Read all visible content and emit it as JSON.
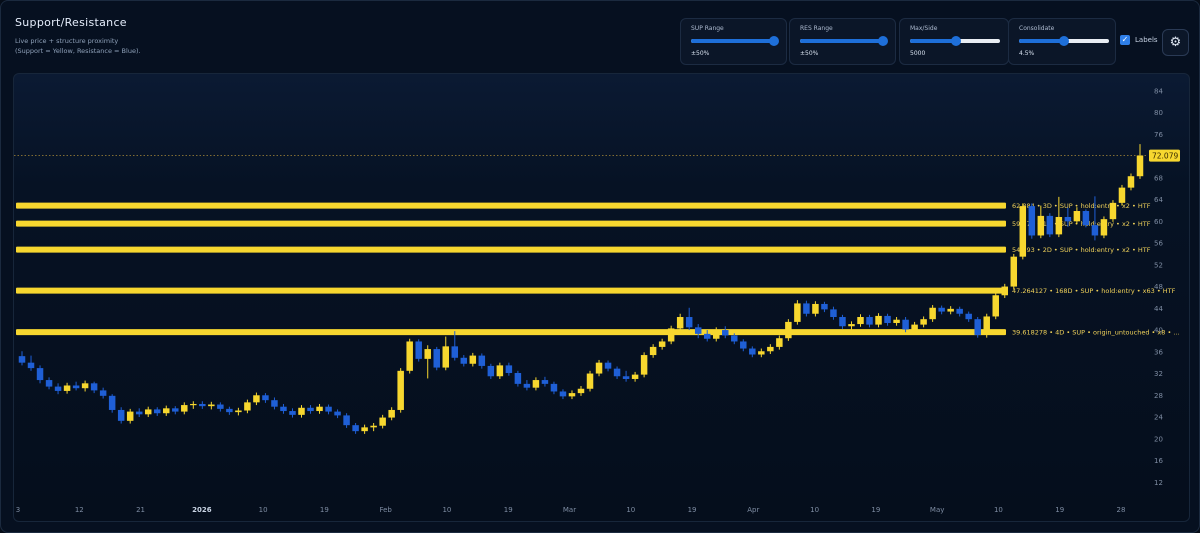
{
  "header": {
    "title": "Support/Resistance",
    "subtitle_line1": "Live price + structure proximity",
    "subtitle_line2": "(Support = Yellow, Resistance = Blue)."
  },
  "controls": {
    "sup_range": {
      "label": "SUP Range",
      "value_text": "±50%",
      "level": 0.98
    },
    "res_range": {
      "label": "RES Range",
      "value_text": "±50%",
      "level": 0.98
    },
    "max_side": {
      "label": "Max/Side",
      "value_text": "5000",
      "level": 0.51
    },
    "consolidate": {
      "label": "Consolidate",
      "value_text": "4.5%",
      "level": 0.5
    },
    "labels_checkbox": {
      "label": "Labels",
      "checked": true,
      "mark": "✓"
    },
    "settings": {
      "icon": "gear-icon",
      "glyph": "⚙"
    }
  },
  "colors": {
    "support": "#f7d72f",
    "resistance": "#1f5fd6",
    "background": "#061020"
  },
  "chart_data": {
    "type": "candlestick",
    "y_ticks": [
      12,
      16,
      20,
      24,
      28,
      32,
      36,
      40,
      44,
      48,
      52,
      56,
      60,
      64,
      68,
      72,
      76,
      80,
      84
    ],
    "ylim": [
      8,
      86
    ],
    "x_ticks": [
      "3",
      "12",
      "21",
      "2026",
      "10",
      "19",
      "Feb",
      "10",
      "19",
      "Mar",
      "10",
      "19",
      "Apr",
      "10",
      "19",
      "May",
      "10",
      "19",
      "28"
    ],
    "current_price": 72.079,
    "current_price_label": "72.079",
    "levels": [
      {
        "price": 62.884,
        "type": "support",
        "label": "62.884 • 3D • SUP • hold:entry • x2 • HTF"
      },
      {
        "price": 59.573,
        "type": "support",
        "label": "59.573 • 1D • SUP • hold:entry • x2 • HTF"
      },
      {
        "price": 54.793,
        "type": "support",
        "label": "54.793 • 2D • SUP • hold:entry • x2 • HTF"
      },
      {
        "price": 47.264127,
        "type": "support",
        "label": "47.264127 • 168D • SUP • hold:entry • x63 • HTF"
      },
      {
        "price": 39.618278,
        "type": "support",
        "label": "39.618278 • 4D • SUP • origin_untouched • x8 • ..."
      }
    ],
    "candles": [
      {
        "o": 35.2,
        "h": 36.1,
        "l": 33.5,
        "c": 34.0
      },
      {
        "o": 34.0,
        "h": 35.3,
        "l": 32.5,
        "c": 33.0
      },
      {
        "o": 33.0,
        "h": 33.5,
        "l": 30.2,
        "c": 30.8
      },
      {
        "o": 30.8,
        "h": 31.3,
        "l": 29.1,
        "c": 29.6
      },
      {
        "o": 29.6,
        "h": 30.2,
        "l": 28.2,
        "c": 28.8
      },
      {
        "o": 28.8,
        "h": 30.3,
        "l": 28.3,
        "c": 29.8
      },
      {
        "o": 29.8,
        "h": 30.5,
        "l": 28.9,
        "c": 29.3
      },
      {
        "o": 29.3,
        "h": 30.7,
        "l": 28.7,
        "c": 30.2
      },
      {
        "o": 30.2,
        "h": 30.5,
        "l": 28.4,
        "c": 28.9
      },
      {
        "o": 28.9,
        "h": 29.4,
        "l": 27.4,
        "c": 27.9
      },
      {
        "o": 27.9,
        "h": 28.2,
        "l": 24.8,
        "c": 25.3
      },
      {
        "o": 25.3,
        "h": 25.8,
        "l": 22.8,
        "c": 23.3
      },
      {
        "o": 23.3,
        "h": 25.5,
        "l": 22.8,
        "c": 25.0
      },
      {
        "o": 25.0,
        "h": 25.6,
        "l": 24.0,
        "c": 24.5
      },
      {
        "o": 24.5,
        "h": 25.9,
        "l": 24.0,
        "c": 25.4
      },
      {
        "o": 25.4,
        "h": 25.8,
        "l": 24.2,
        "c": 24.7
      },
      {
        "o": 24.7,
        "h": 26.1,
        "l": 24.2,
        "c": 25.6
      },
      {
        "o": 25.6,
        "h": 26.0,
        "l": 24.5,
        "c": 25.0
      },
      {
        "o": 25.0,
        "h": 26.7,
        "l": 24.5,
        "c": 26.2
      },
      {
        "o": 26.2,
        "h": 26.9,
        "l": 25.5,
        "c": 26.4
      },
      {
        "o": 26.4,
        "h": 26.9,
        "l": 25.5,
        "c": 26.0
      },
      {
        "o": 26.0,
        "h": 26.8,
        "l": 25.4,
        "c": 26.3
      },
      {
        "o": 26.3,
        "h": 26.7,
        "l": 25.0,
        "c": 25.5
      },
      {
        "o": 25.5,
        "h": 25.9,
        "l": 24.4,
        "c": 24.9
      },
      {
        "o": 24.9,
        "h": 25.7,
        "l": 24.3,
        "c": 25.2
      },
      {
        "o": 25.2,
        "h": 27.2,
        "l": 24.7,
        "c": 26.7
      },
      {
        "o": 26.7,
        "h": 28.5,
        "l": 26.2,
        "c": 28.0
      },
      {
        "o": 28.0,
        "h": 28.4,
        "l": 26.6,
        "c": 27.1
      },
      {
        "o": 27.1,
        "h": 27.6,
        "l": 25.4,
        "c": 25.9
      },
      {
        "o": 25.9,
        "h": 26.4,
        "l": 24.6,
        "c": 25.1
      },
      {
        "o": 25.1,
        "h": 25.6,
        "l": 23.9,
        "c": 24.4
      },
      {
        "o": 24.4,
        "h": 26.2,
        "l": 23.9,
        "c": 25.7
      },
      {
        "o": 25.7,
        "h": 26.2,
        "l": 24.6,
        "c": 25.1
      },
      {
        "o": 25.1,
        "h": 26.4,
        "l": 24.6,
        "c": 25.9
      },
      {
        "o": 25.9,
        "h": 26.3,
        "l": 24.5,
        "c": 25.0
      },
      {
        "o": 25.0,
        "h": 25.4,
        "l": 23.8,
        "c": 24.3
      },
      {
        "o": 24.3,
        "h": 24.7,
        "l": 22.0,
        "c": 22.5
      },
      {
        "o": 22.5,
        "h": 22.9,
        "l": 20.9,
        "c": 21.4
      },
      {
        "o": 21.4,
        "h": 22.6,
        "l": 20.9,
        "c": 22.1
      },
      {
        "o": 22.1,
        "h": 22.9,
        "l": 21.4,
        "c": 22.4
      },
      {
        "o": 22.4,
        "h": 24.4,
        "l": 21.9,
        "c": 23.9
      },
      {
        "o": 23.9,
        "h": 25.8,
        "l": 23.4,
        "c": 25.3
      },
      {
        "o": 25.3,
        "h": 33.0,
        "l": 24.8,
        "c": 32.5
      },
      {
        "o": 32.5,
        "h": 38.4,
        "l": 32.0,
        "c": 37.9
      },
      {
        "o": 37.9,
        "h": 38.3,
        "l": 34.2,
        "c": 34.7
      },
      {
        "o": 34.7,
        "h": 37.2,
        "l": 31.1,
        "c": 36.5
      },
      {
        "o": 36.5,
        "h": 36.9,
        "l": 32.6,
        "c": 33.1
      },
      {
        "o": 33.1,
        "h": 38.8,
        "l": 32.6,
        "c": 37.0
      },
      {
        "o": 37.0,
        "h": 39.8,
        "l": 34.4,
        "c": 34.9
      },
      {
        "o": 34.9,
        "h": 35.4,
        "l": 33.3,
        "c": 33.8
      },
      {
        "o": 33.8,
        "h": 35.8,
        "l": 33.3,
        "c": 35.3
      },
      {
        "o": 35.3,
        "h": 35.7,
        "l": 32.9,
        "c": 33.4
      },
      {
        "o": 33.4,
        "h": 33.8,
        "l": 31.0,
        "c": 31.5
      },
      {
        "o": 31.5,
        "h": 34.0,
        "l": 31.0,
        "c": 33.5
      },
      {
        "o": 33.5,
        "h": 34.0,
        "l": 31.6,
        "c": 32.1
      },
      {
        "o": 32.1,
        "h": 32.5,
        "l": 29.6,
        "c": 30.1
      },
      {
        "o": 30.1,
        "h": 30.8,
        "l": 28.9,
        "c": 29.4
      },
      {
        "o": 29.4,
        "h": 31.3,
        "l": 28.9,
        "c": 30.8
      },
      {
        "o": 30.8,
        "h": 31.4,
        "l": 29.6,
        "c": 30.1
      },
      {
        "o": 30.1,
        "h": 30.5,
        "l": 28.2,
        "c": 28.7
      },
      {
        "o": 28.7,
        "h": 29.1,
        "l": 27.3,
        "c": 27.8
      },
      {
        "o": 27.8,
        "h": 28.9,
        "l": 27.3,
        "c": 28.4
      },
      {
        "o": 28.4,
        "h": 29.7,
        "l": 27.9,
        "c": 29.2
      },
      {
        "o": 29.2,
        "h": 32.5,
        "l": 28.7,
        "c": 32.0
      },
      {
        "o": 32.0,
        "h": 34.5,
        "l": 31.5,
        "c": 34.0
      },
      {
        "o": 34.0,
        "h": 34.4,
        "l": 32.4,
        "c": 32.9
      },
      {
        "o": 32.9,
        "h": 33.3,
        "l": 31.0,
        "c": 31.5
      },
      {
        "o": 31.5,
        "h": 32.5,
        "l": 30.5,
        "c": 31.0
      },
      {
        "o": 31.0,
        "h": 32.3,
        "l": 30.5,
        "c": 31.8
      },
      {
        "o": 31.8,
        "h": 35.9,
        "l": 31.3,
        "c": 35.4
      },
      {
        "o": 35.4,
        "h": 37.4,
        "l": 34.9,
        "c": 36.9
      },
      {
        "o": 36.9,
        "h": 38.4,
        "l": 36.4,
        "c": 37.9
      },
      {
        "o": 37.9,
        "h": 40.8,
        "l": 37.4,
        "c": 40.3
      },
      {
        "o": 40.3,
        "h": 43.0,
        "l": 39.5,
        "c": 42.4
      },
      {
        "o": 42.4,
        "h": 44.1,
        "l": 40.0,
        "c": 40.5
      },
      {
        "o": 40.5,
        "h": 41.1,
        "l": 38.5,
        "c": 39.3
      },
      {
        "o": 39.3,
        "h": 40.0,
        "l": 37.9,
        "c": 38.4
      },
      {
        "o": 38.4,
        "h": 40.5,
        "l": 37.9,
        "c": 40.0
      },
      {
        "o": 40.0,
        "h": 40.7,
        "l": 38.5,
        "c": 39.0
      },
      {
        "o": 39.0,
        "h": 39.4,
        "l": 37.4,
        "c": 37.9
      },
      {
        "o": 37.9,
        "h": 38.3,
        "l": 36.1,
        "c": 36.6
      },
      {
        "o": 36.6,
        "h": 37.0,
        "l": 35.0,
        "c": 35.5
      },
      {
        "o": 35.5,
        "h": 36.6,
        "l": 35.0,
        "c": 36.1
      },
      {
        "o": 36.1,
        "h": 37.4,
        "l": 35.6,
        "c": 36.9
      },
      {
        "o": 36.9,
        "h": 39.0,
        "l": 36.4,
        "c": 38.5
      },
      {
        "o": 38.5,
        "h": 42.0,
        "l": 38.0,
        "c": 41.5
      },
      {
        "o": 41.5,
        "h": 45.5,
        "l": 41.0,
        "c": 44.9
      },
      {
        "o": 44.9,
        "h": 45.4,
        "l": 42.5,
        "c": 43.0
      },
      {
        "o": 43.0,
        "h": 45.3,
        "l": 42.5,
        "c": 44.8
      },
      {
        "o": 44.8,
        "h": 45.2,
        "l": 43.3,
        "c": 43.8
      },
      {
        "o": 43.8,
        "h": 44.3,
        "l": 41.9,
        "c": 42.4
      },
      {
        "o": 42.4,
        "h": 42.8,
        "l": 40.2,
        "c": 40.7
      },
      {
        "o": 40.7,
        "h": 41.6,
        "l": 39.9,
        "c": 41.1
      },
      {
        "o": 41.1,
        "h": 42.9,
        "l": 40.6,
        "c": 42.4
      },
      {
        "o": 42.4,
        "h": 42.8,
        "l": 40.5,
        "c": 41.0
      },
      {
        "o": 41.0,
        "h": 43.1,
        "l": 40.5,
        "c": 42.6
      },
      {
        "o": 42.6,
        "h": 43.0,
        "l": 40.8,
        "c": 41.3
      },
      {
        "o": 41.3,
        "h": 42.4,
        "l": 40.8,
        "c": 41.9
      },
      {
        "o": 41.9,
        "h": 42.4,
        "l": 39.6,
        "c": 40.1
      },
      {
        "o": 40.1,
        "h": 41.5,
        "l": 39.6,
        "c": 41.0
      },
      {
        "o": 41.0,
        "h": 42.5,
        "l": 40.5,
        "c": 42.0
      },
      {
        "o": 42.0,
        "h": 44.6,
        "l": 41.5,
        "c": 44.1
      },
      {
        "o": 44.1,
        "h": 44.5,
        "l": 42.9,
        "c": 43.4
      },
      {
        "o": 43.4,
        "h": 44.4,
        "l": 42.9,
        "c": 43.9
      },
      {
        "o": 43.9,
        "h": 44.3,
        "l": 42.5,
        "c": 43.0
      },
      {
        "o": 43.0,
        "h": 43.4,
        "l": 41.5,
        "c": 42.0
      },
      {
        "o": 42.0,
        "h": 42.4,
        "l": 38.6,
        "c": 39.1
      },
      {
        "o": 39.1,
        "h": 43.0,
        "l": 38.6,
        "c": 42.5
      },
      {
        "o": 42.5,
        "h": 47.0,
        "l": 42.0,
        "c": 46.4
      },
      {
        "o": 46.4,
        "h": 48.5,
        "l": 45.9,
        "c": 48.0
      },
      {
        "o": 48.0,
        "h": 54.0,
        "l": 47.5,
        "c": 53.5
      },
      {
        "o": 53.5,
        "h": 63.3,
        "l": 53.0,
        "c": 62.8
      },
      {
        "o": 62.8,
        "h": 63.3,
        "l": 56.8,
        "c": 57.4
      },
      {
        "o": 57.4,
        "h": 62.9,
        "l": 56.9,
        "c": 61.0
      },
      {
        "o": 61.0,
        "h": 61.5,
        "l": 57.1,
        "c": 57.6
      },
      {
        "o": 57.6,
        "h": 64.5,
        "l": 57.1,
        "c": 60.8
      },
      {
        "o": 60.8,
        "h": 62.5,
        "l": 59.0,
        "c": 60.0
      },
      {
        "o": 60.0,
        "h": 62.6,
        "l": 59.5,
        "c": 61.9
      },
      {
        "o": 61.9,
        "h": 62.2,
        "l": 58.9,
        "c": 59.3
      },
      {
        "o": 59.3,
        "h": 64.6,
        "l": 56.5,
        "c": 57.4
      },
      {
        "o": 57.4,
        "h": 60.9,
        "l": 56.9,
        "c": 60.4
      },
      {
        "o": 60.4,
        "h": 63.9,
        "l": 59.9,
        "c": 63.4
      },
      {
        "o": 63.4,
        "h": 66.7,
        "l": 62.9,
        "c": 66.2
      },
      {
        "o": 66.2,
        "h": 68.8,
        "l": 65.7,
        "c": 68.3
      },
      {
        "o": 68.3,
        "h": 74.2,
        "l": 67.8,
        "c": 72.1
      }
    ]
  }
}
